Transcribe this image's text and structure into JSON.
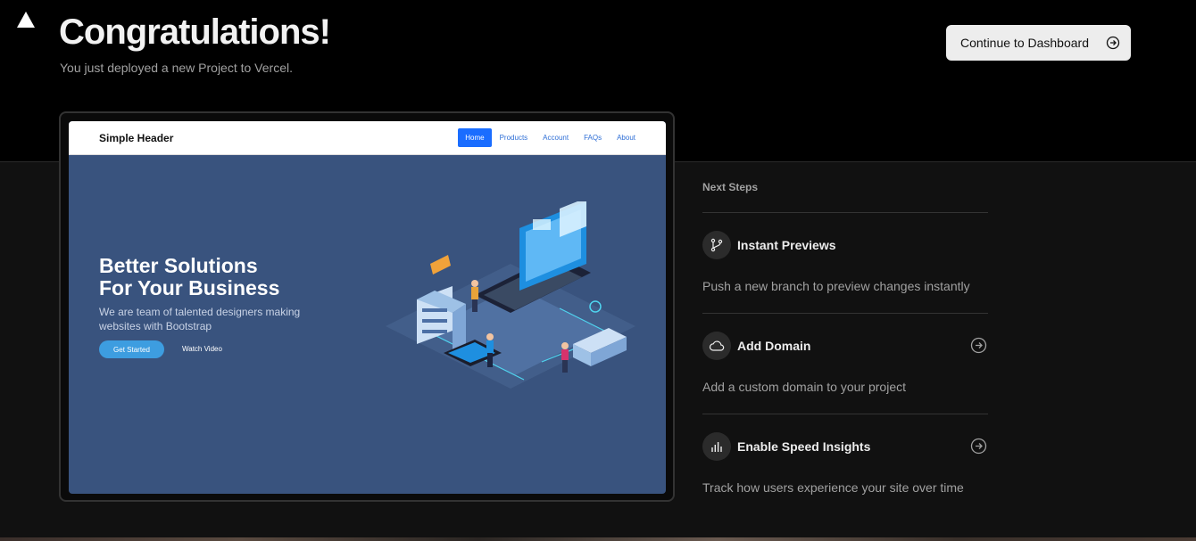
{
  "header": {
    "title": "Congratulations!",
    "subtitle": "You just deployed a new Project to Vercel.",
    "dashboard_button": "Continue to Dashboard"
  },
  "preview": {
    "brand": "Simple Header",
    "nav": [
      "Home",
      "Products",
      "Account",
      "FAQs",
      "About"
    ],
    "hero_title_line1": "Better Solutions",
    "hero_title_line2": "For Your Business",
    "hero_sub": "We are team of talented designers making websites with Bootstrap",
    "get_started": "Get Started",
    "watch_video": "Watch Video"
  },
  "next_steps": {
    "heading": "Next Steps",
    "items": [
      {
        "icon": "branch-icon",
        "title": "Instant Previews",
        "desc": "Push a new branch to preview changes instantly"
      },
      {
        "icon": "cloud-icon",
        "title": "Add Domain",
        "desc": "Add a custom domain to your project"
      },
      {
        "icon": "bar-chart-icon",
        "title": "Enable Speed Insights",
        "desc": "Track how users experience your site over time"
      }
    ]
  },
  "colors": {
    "accent_blue": "#1a6dff",
    "hero_bg": "#39537e",
    "button_bg": "#ededed"
  }
}
